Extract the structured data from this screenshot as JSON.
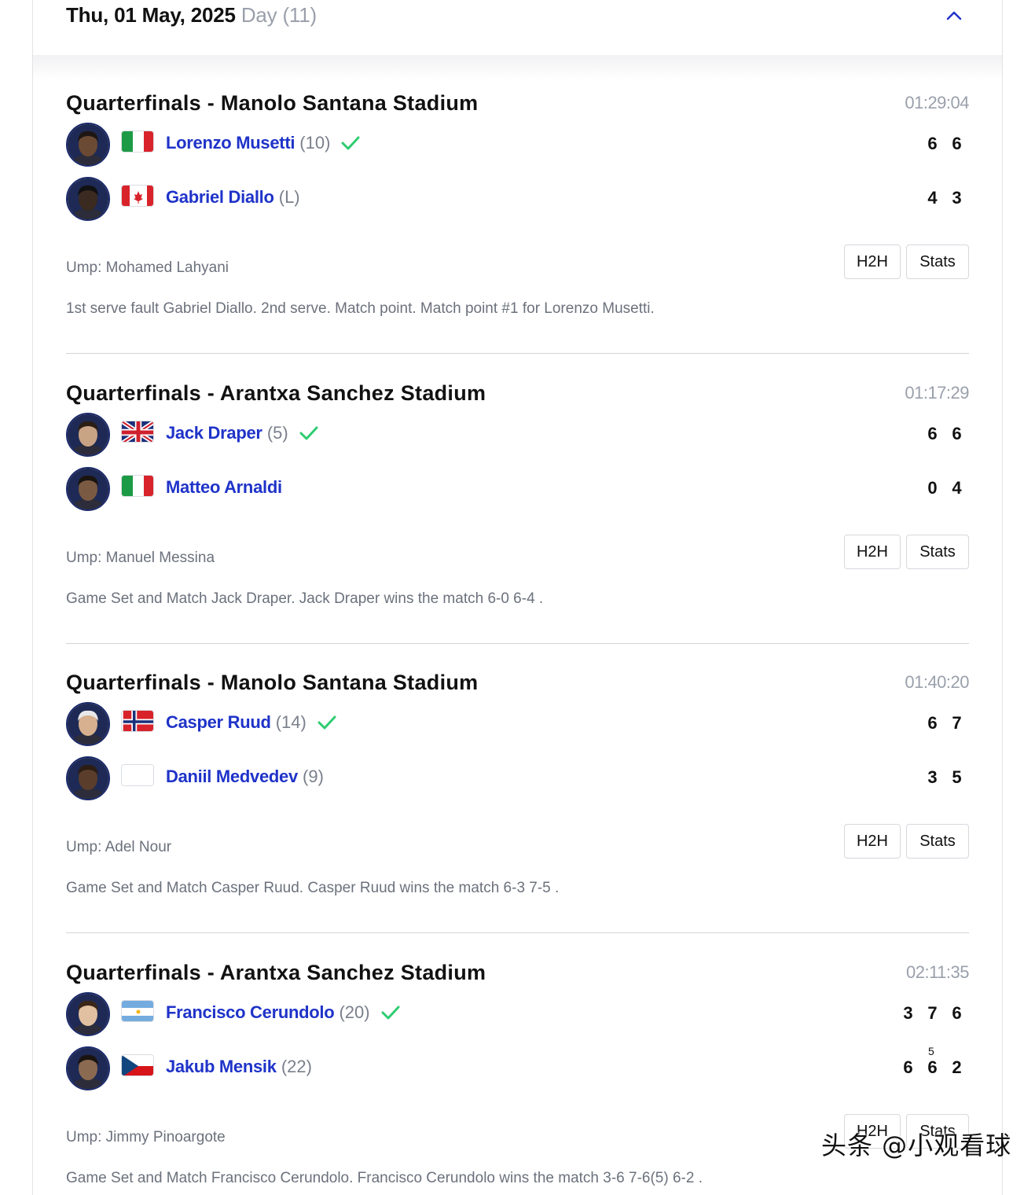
{
  "header": {
    "date": "Thu, 01 May, 2025",
    "day_label": "Day (11)"
  },
  "matches": [
    {
      "title": "Quarterfinals - Manolo Santana Stadium",
      "duration": "01:29:04",
      "players": [
        {
          "name": "Lorenzo Musetti",
          "seed": "(10)",
          "winner": true,
          "flag": "italy-flag",
          "scores": [
            "6",
            "6"
          ]
        },
        {
          "name": "Gabriel Diallo",
          "seed": "(L)",
          "winner": false,
          "flag": "canada-flag",
          "scores": [
            "4",
            "3"
          ]
        }
      ],
      "umpire": "Ump: Mohamed Lahyani",
      "h2h_label": "H2H",
      "stats_label": "Stats",
      "commentary": "1st serve fault Gabriel Diallo. 2nd serve. Match point. Match point #1 for Lorenzo Musetti."
    },
    {
      "title": "Quarterfinals - Arantxa Sanchez Stadium",
      "duration": "01:17:29",
      "players": [
        {
          "name": "Jack Draper",
          "seed": "(5)",
          "winner": true,
          "flag": "uk-flag",
          "scores": [
            "6",
            "6"
          ]
        },
        {
          "name": "Matteo Arnaldi",
          "seed": "",
          "winner": false,
          "flag": "italy-flag",
          "scores": [
            "0",
            "4"
          ]
        }
      ],
      "umpire": "Ump: Manuel Messina",
      "h2h_label": "H2H",
      "stats_label": "Stats",
      "commentary": "Game Set and Match Jack Draper. Jack Draper wins the match 6-0 6-4 ."
    },
    {
      "title": "Quarterfinals - Manolo Santana Stadium",
      "duration": "01:40:20",
      "players": [
        {
          "name": "Casper Ruud",
          "seed": "(14)",
          "winner": true,
          "flag": "norway-flag",
          "scores": [
            "6",
            "7"
          ]
        },
        {
          "name": "Daniil Medvedev",
          "seed": "(9)",
          "winner": false,
          "flag": "blank-flag",
          "scores": [
            "3",
            "5"
          ]
        }
      ],
      "umpire": "Ump: Adel Nour",
      "h2h_label": "H2H",
      "stats_label": "Stats",
      "commentary": "Game Set and Match Casper Ruud. Casper Ruud wins the match 6-3 7-5 ."
    },
    {
      "title": "Quarterfinals - Arantxa Sanchez Stadium",
      "duration": "02:11:35",
      "players": [
        {
          "name": "Francisco Cerundolo",
          "seed": "(20)",
          "winner": true,
          "flag": "argentina-flag",
          "scores": [
            "3",
            "7",
            "6"
          ]
        },
        {
          "name": "Jakub Mensik",
          "seed": "(22)",
          "winner": false,
          "flag": "czech-flag",
          "scores": [
            "6",
            "6",
            "2"
          ],
          "tiebreak": "5"
        }
      ],
      "umpire": "Ump: Jimmy Pinoargote",
      "h2h_label": "H2H",
      "stats_label": "Stats",
      "commentary": "Game Set and Match Francisco Cerundolo. Francisco Cerundolo wins the match 3-6 7-6(5) 6-2 ."
    }
  ],
  "watermark": "头条 @小观看球",
  "colors": {
    "player_link": "#1f33c9",
    "winner_check": "#2ecc71",
    "muted": "#6b717c"
  }
}
